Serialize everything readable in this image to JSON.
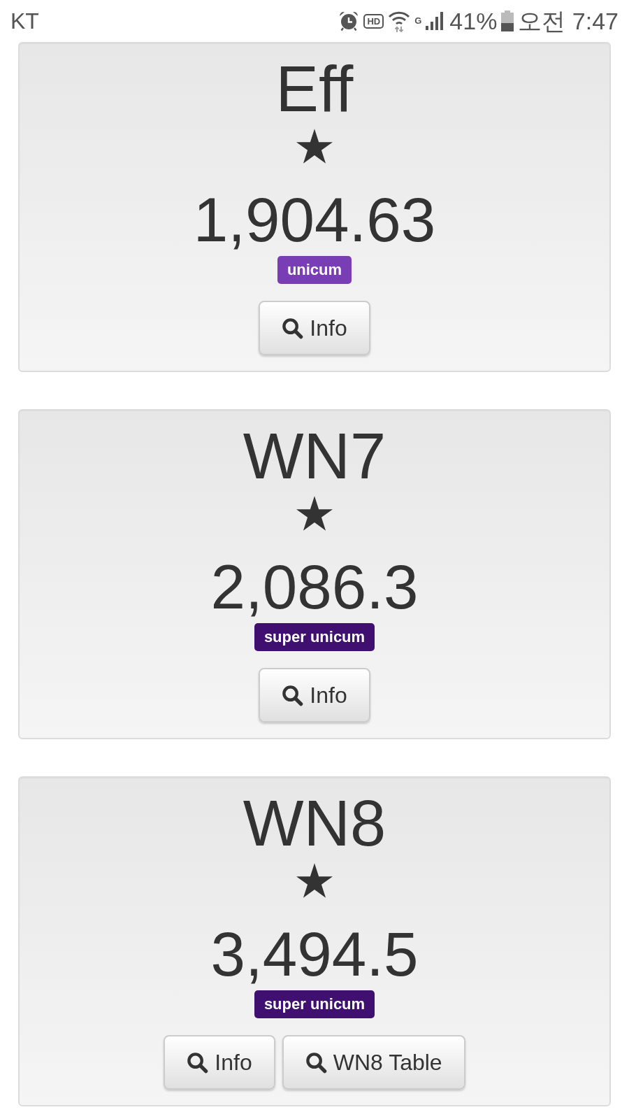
{
  "status_bar": {
    "carrier": "KT",
    "hd_label": "HD",
    "network_type": "G",
    "battery_text": "41%",
    "time": "오전 7:47"
  },
  "cards": [
    {
      "title": "Eff",
      "value": "1,904.63",
      "badge": {
        "label": "unicum",
        "color": "#793db6"
      },
      "buttons": [
        {
          "label": "Info"
        }
      ]
    },
    {
      "title": "WN7",
      "value": "2,086.3",
      "badge": {
        "label": "super unicum",
        "color": "#401070"
      },
      "buttons": [
        {
          "label": "Info"
        }
      ]
    },
    {
      "title": "WN8",
      "value": "3,494.5",
      "badge": {
        "label": "super unicum",
        "color": "#401070"
      },
      "buttons": [
        {
          "label": "Info"
        },
        {
          "label": "WN8 Table"
        }
      ]
    }
  ]
}
